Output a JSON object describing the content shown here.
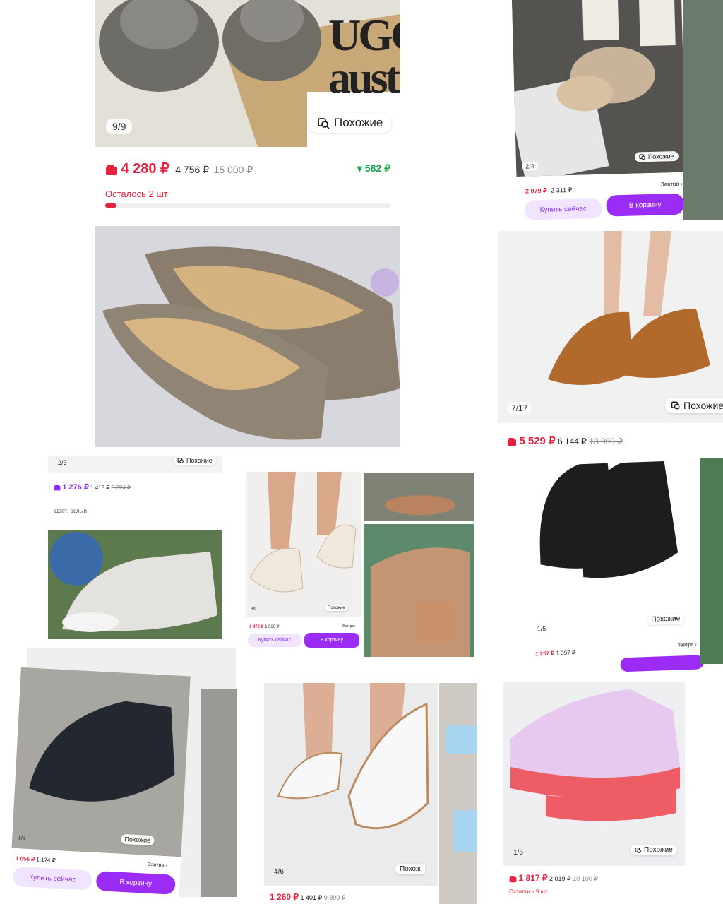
{
  "similar_label": "Похожие",
  "card1": {
    "counter": "9/9",
    "price": "4 280 ₽",
    "price2": "4 756 ₽",
    "old_price": "15 000 ₽",
    "discount": "▾ 582 ₽",
    "remaining": "Осталось 2 шт",
    "brand_text": "UGG australia"
  },
  "card2": {
    "counter": "2/4",
    "price": "2 079 ₽",
    "price2": "2 311 ₽",
    "delivery": "Завтра ›",
    "buy_label": "Купить сейчас",
    "cart_label": "В корзину"
  },
  "card3": {
    "counter": "7/17",
    "price": "5 529 ₽",
    "price2": "6 144 ₽",
    "old_price": "13 999 ₽"
  },
  "card4": {
    "counter": "2/3",
    "price": "1 276 ₽",
    "price2": "1 418 ₽",
    "old_price": "3 224 ₽",
    "color_label": "Цвет: белый"
  },
  "card5": {
    "counter": "3/9",
    "price": "1 472 ₽",
    "price2": "1 636 ₽",
    "delivery": "Завтра ›",
    "buy_label": "Купить сейчас",
    "cart_label": "В корзину"
  },
  "card6": {
    "counter": "1/5",
    "price": "1 257 ₽",
    "price2": "1 397 ₽",
    "delivery": "Завтра ›"
  },
  "card7": {
    "counter": "1/3",
    "price": "1 056 ₽",
    "price2": "1 174 ₽",
    "delivery": "Завтра ›",
    "buy_label": "Купить сейчас",
    "cart_label": "В корзину"
  },
  "card8": {
    "counter": "4/6",
    "price": "1 260 ₽",
    "price2": "1 401 ₽",
    "old_price": "9 899 ₽",
    "similar_cut": "Похож"
  },
  "card9": {
    "counter": "1/6",
    "price": "1 817 ₽",
    "price2": "2 019 ₽",
    "old_price": "10 100 ₽",
    "remaining_cut": "Осталось 9 шт"
  },
  "colors": {
    "red": "#e5233f",
    "purple": "#8b2cf5",
    "green": "#1aa14b",
    "light_purple": "#f1e4ff"
  }
}
